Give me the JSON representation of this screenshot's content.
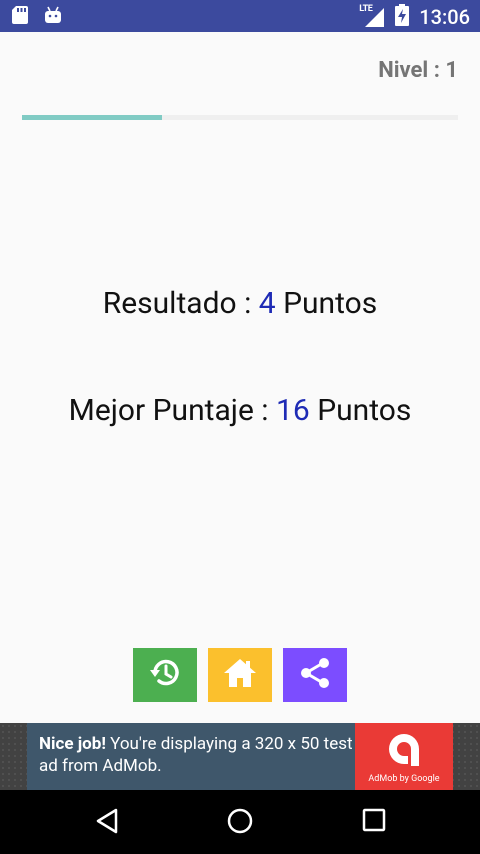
{
  "status_bar": {
    "time": "13:06",
    "network": "LTE",
    "icons": [
      "sd-card-icon",
      "android-icon",
      "lte-signal-icon",
      "battery-charging-icon"
    ]
  },
  "game": {
    "level_text": "Nivel : 1",
    "level_progress_percent": 32,
    "result": {
      "label": "Resultado : ",
      "value": "4",
      "unit": " Puntos"
    },
    "best": {
      "label": "Mejor Puntaje : ",
      "value": "16",
      "unit": " Puntos"
    },
    "buttons": [
      {
        "name": "replay",
        "icon": "replay-icon",
        "color": "#4caf50"
      },
      {
        "name": "home",
        "icon": "home-icon",
        "color": "#fbc02d"
      },
      {
        "name": "share",
        "icon": "share-icon",
        "color": "#7c4dff"
      }
    ]
  },
  "ad": {
    "headline": "Nice job!",
    "body": " You're displaying a 320 x 50 test ad from AdMob.",
    "brand": "AdMob by Google"
  },
  "navbar": {
    "icons": [
      "back-icon",
      "home-circle-icon",
      "recent-apps-icon"
    ]
  },
  "colors": {
    "status_bar": "#3c4a9e",
    "accent_number": "#1e2bb5",
    "progress": "#80cbc4"
  }
}
